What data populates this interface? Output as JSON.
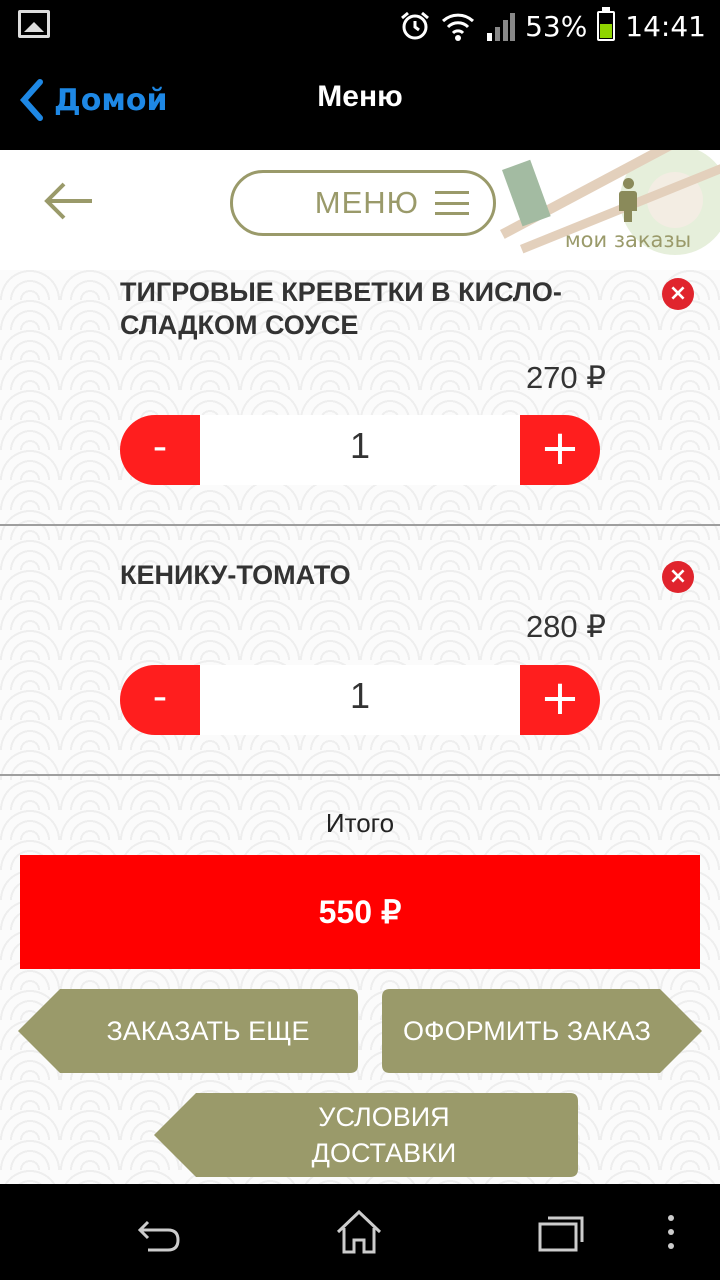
{
  "status_bar": {
    "battery": "53%",
    "time": "14:41",
    "battery_level": 0.53
  },
  "action_bar": {
    "back_label": "Домой",
    "title": "Меню"
  },
  "top_bar": {
    "menu_label": "МЕНЮ",
    "orders_label": "мои заказы"
  },
  "items": [
    {
      "name": "ТИГРОВЫЕ КРЕВЕТКИ В КИСЛО-СЛАДКОМ СОУСЕ",
      "price": "270 ₽",
      "quantity": "1",
      "minus": "-",
      "plus": "+",
      "remove": "×"
    },
    {
      "name": "КЕНИКУ-ТОМАТО",
      "price": "280 ₽",
      "quantity": "1",
      "minus": "-",
      "plus": "+",
      "remove": "×"
    }
  ],
  "total": {
    "label": "Итого",
    "value": "550 ₽"
  },
  "buttons": {
    "order_more": "ЗАКАЗАТЬ ЕЩЕ",
    "checkout": "ОФОРМИТЬ ЗАКАЗ",
    "delivery_terms_line1": "УСЛОВИЯ",
    "delivery_terms_line2": "ДОСТАВКИ"
  },
  "colors": {
    "accent_red": "#ff1e1e",
    "olive": "#9a9a6a",
    "link_blue": "#1e88e5"
  }
}
